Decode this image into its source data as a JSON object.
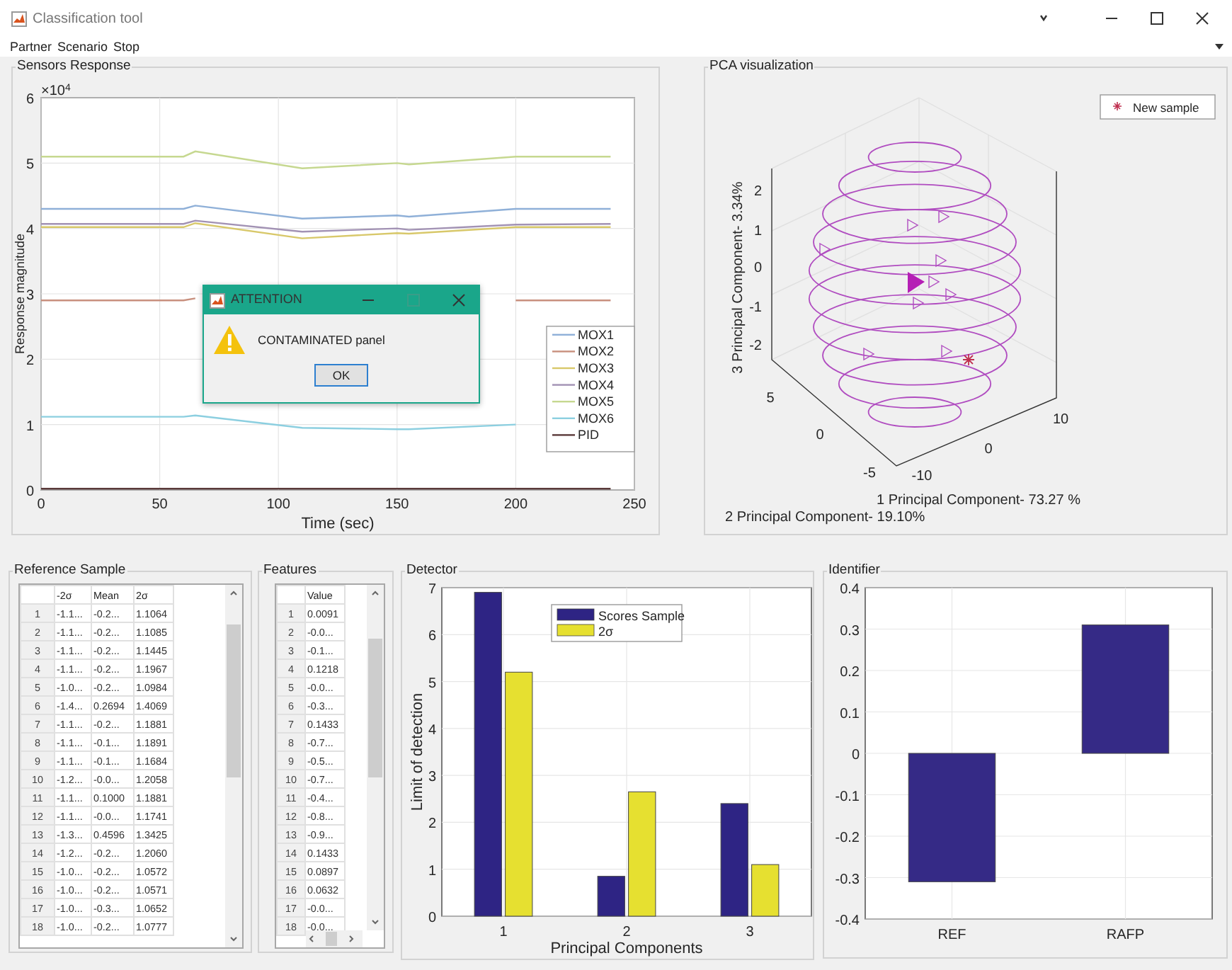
{
  "window": {
    "title": "Classification tool"
  },
  "menu": [
    "Partner",
    "Scenario",
    "Stop"
  ],
  "sensors_panel": {
    "title": "Sensors Response",
    "y_multiplier": "×10$^{4}$",
    "chart_data": {
      "type": "line",
      "grid": true,
      "legend": true,
      "xlabel": "Time (sec)",
      "ylabel": "Response magnitude",
      "x": [
        0,
        60,
        65,
        110,
        150,
        155,
        200,
        240
      ],
      "xlim": [
        0,
        250
      ],
      "ylim": [
        0,
        6
      ],
      "xticks": [
        0,
        50,
        100,
        150,
        200,
        250
      ],
      "yticks": [
        0,
        1,
        2,
        3,
        4,
        5,
        6
      ],
      "series": [
        {
          "name": "MOX1",
          "color": "#8fb0d8",
          "values": [
            4.3,
            4.3,
            4.35,
            4.15,
            4.2,
            4.18,
            4.3,
            4.3
          ]
        },
        {
          "name": "MOX2",
          "color": "#c8907e",
          "values": [
            2.9,
            2.9,
            2.93,
            null,
            null,
            null,
            2.9,
            2.9
          ]
        },
        {
          "name": "MOX3",
          "color": "#d8c86a",
          "values": [
            4.02,
            4.02,
            4.08,
            3.85,
            3.93,
            3.92,
            4.02,
            4.02
          ]
        },
        {
          "name": "MOX4",
          "color": "#a292b4",
          "values": [
            4.07,
            4.07,
            4.12,
            3.95,
            4.0,
            3.98,
            4.06,
            4.07
          ]
        },
        {
          "name": "MOX5",
          "color": "#c6d890",
          "values": [
            5.1,
            5.1,
            5.18,
            4.92,
            5.0,
            4.98,
            5.1,
            5.1
          ]
        },
        {
          "name": "MOX6",
          "color": "#8ccfe0",
          "values": [
            1.12,
            1.12,
            1.14,
            0.95,
            0.93,
            0.93,
            1.0,
            null
          ]
        },
        {
          "name": "PID",
          "color": "#5a3a3a",
          "values": [
            0.02,
            0.02,
            0.02,
            0.02,
            0.02,
            0.02,
            0.02,
            0.02
          ]
        }
      ]
    }
  },
  "dialog": {
    "title": "ATTENTION",
    "message": "CONTAMINATED panel",
    "button": "OK"
  },
  "pca_panel": {
    "title": "PCA visualization",
    "legend": "New sample",
    "xlabel": "1 Principal Component- 73.27 %",
    "ylabel": "2 Principal Component- 19.10%",
    "zlabel": "3 Principal Component- 3.34%",
    "xticks": [
      "-10",
      "0",
      "10"
    ],
    "yticks": [
      "5",
      "0",
      "-5"
    ],
    "zticks": [
      "2",
      "1",
      "0",
      "-1",
      "-2"
    ]
  },
  "reference_panel": {
    "title": "Reference Sample",
    "columns": [
      "",
      "-2σ",
      "Mean",
      "2σ"
    ],
    "rows": [
      [
        "1",
        "-1.1...",
        "-0.2...",
        "1.1064"
      ],
      [
        "2",
        "-1.1...",
        "-0.2...",
        "1.1085"
      ],
      [
        "3",
        "-1.1...",
        "-0.2...",
        "1.1445"
      ],
      [
        "4",
        "-1.1...",
        "-0.2...",
        "1.1967"
      ],
      [
        "5",
        "-1.0...",
        "-0.2...",
        "1.0984"
      ],
      [
        "6",
        "-1.4...",
        "0.2694",
        "1.4069"
      ],
      [
        "7",
        "-1.1...",
        "-0.2...",
        "1.1881"
      ],
      [
        "8",
        "-1.1...",
        "-0.1...",
        "1.1891"
      ],
      [
        "9",
        "-1.1...",
        "-0.1...",
        "1.1684"
      ],
      [
        "10",
        "-1.2...",
        "-0.0...",
        "1.2058"
      ],
      [
        "11",
        "-1.1...",
        "0.1000",
        "1.1881"
      ],
      [
        "12",
        "-1.1...",
        "-0.0...",
        "1.1741"
      ],
      [
        "13",
        "-1.3...",
        "0.4596",
        "1.3425"
      ],
      [
        "14",
        "-1.2...",
        "-0.2...",
        "1.2060"
      ],
      [
        "15",
        "-1.0...",
        "-0.2...",
        "1.0572"
      ],
      [
        "16",
        "-1.0...",
        "-0.2...",
        "1.0571"
      ],
      [
        "17",
        "-1.0...",
        "-0.3...",
        "1.0652"
      ],
      [
        "18",
        "-1.0...",
        "-0.2...",
        "1.0777"
      ]
    ]
  },
  "features_panel": {
    "title": "Features",
    "columns": [
      "",
      "Value"
    ],
    "rows": [
      [
        "1",
        "0.0091"
      ],
      [
        "2",
        "-0.0..."
      ],
      [
        "3",
        "-0.1..."
      ],
      [
        "4",
        "0.1218"
      ],
      [
        "5",
        "-0.0..."
      ],
      [
        "6",
        "-0.3..."
      ],
      [
        "7",
        "0.1433"
      ],
      [
        "8",
        "-0.7..."
      ],
      [
        "9",
        "-0.5..."
      ],
      [
        "10",
        "-0.7..."
      ],
      [
        "11",
        "-0.4..."
      ],
      [
        "12",
        "-0.8..."
      ],
      [
        "13",
        "-0.9..."
      ],
      [
        "14",
        "0.1433"
      ],
      [
        "15",
        "0.0897"
      ],
      [
        "16",
        "0.0632"
      ],
      [
        "17",
        "-0.0..."
      ],
      [
        "18",
        "-0.0..."
      ]
    ]
  },
  "detector_panel": {
    "title": "Detector",
    "chart_data": {
      "type": "bar",
      "grid": true,
      "legend": true,
      "xlabel": "Principal Components",
      "ylabel": "Limit of detection",
      "categories": [
        "1",
        "2",
        "3"
      ],
      "ylim": [
        0,
        7
      ],
      "yticks": [
        0,
        1,
        2,
        3,
        4,
        5,
        6,
        7
      ],
      "series": [
        {
          "name": "Scores Sample",
          "color": "#2e2484",
          "values": [
            6.9,
            0.85,
            2.4
          ]
        },
        {
          "name": "2σ",
          "color": "#e6e030",
          "values": [
            5.2,
            2.65,
            1.1
          ]
        }
      ]
    }
  },
  "identifier_panel": {
    "title": "Identifier",
    "chart_data": {
      "type": "bar",
      "grid": true,
      "categories": [
        "REF",
        "RAFP"
      ],
      "values": [
        -0.31,
        0.31
      ],
      "ylim": [
        -0.4,
        0.4
      ],
      "yticks": [
        -0.4,
        -0.3,
        -0.2,
        -0.1,
        0,
        0.1,
        0.2,
        0.3,
        0.4
      ]
    }
  }
}
